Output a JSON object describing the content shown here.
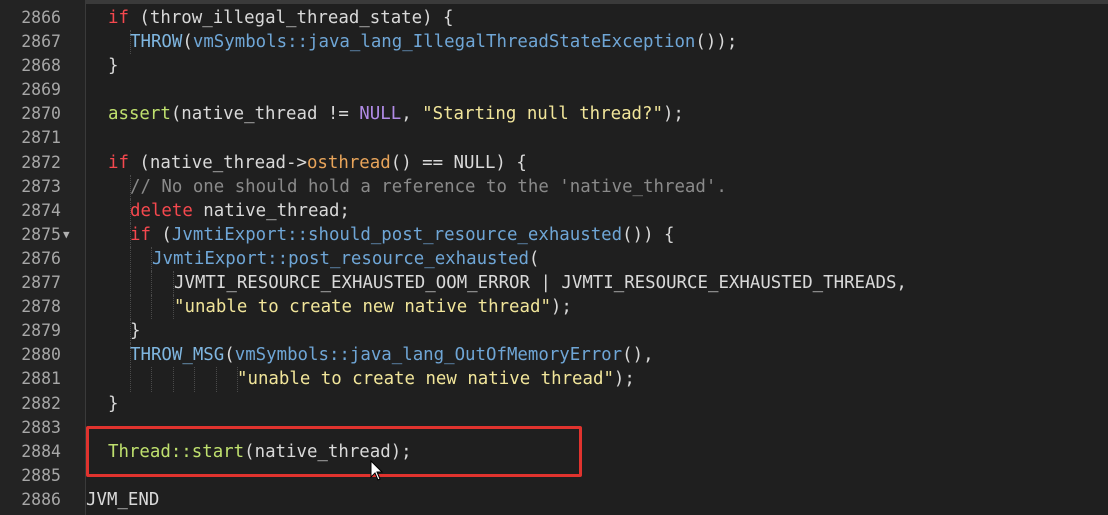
{
  "editor": {
    "lines": [
      {
        "num": "2866",
        "indent": 1,
        "tokens": [
          {
            "t": "if",
            "c": "kw"
          },
          {
            "t": " (throw_illegal_thread_state) {",
            "c": ""
          }
        ]
      },
      {
        "num": "2867",
        "indent": 2,
        "tokens": [
          {
            "t": "THROW",
            "c": "fn"
          },
          {
            "t": "(",
            "c": ""
          },
          {
            "t": "vmSymbols::java_lang_IllegalThreadStateException",
            "c": "ty"
          },
          {
            "t": "());",
            "c": ""
          }
        ]
      },
      {
        "num": "2868",
        "indent": 1,
        "tokens": [
          {
            "t": "}",
            "c": ""
          }
        ]
      },
      {
        "num": "2869",
        "indent": 0,
        "tokens": []
      },
      {
        "num": "2870",
        "indent": 1,
        "tokens": [
          {
            "t": "assert",
            "c": "asrt"
          },
          {
            "t": "(native_thread != ",
            "c": ""
          },
          {
            "t": "NULL",
            "c": "nul"
          },
          {
            "t": ", ",
            "c": ""
          },
          {
            "t": "\"Starting null thread?\"",
            "c": "str"
          },
          {
            "t": ");",
            "c": ""
          }
        ]
      },
      {
        "num": "2871",
        "indent": 0,
        "tokens": []
      },
      {
        "num": "2872",
        "indent": 1,
        "tokens": [
          {
            "t": "if",
            "c": "kw"
          },
          {
            "t": " (native_thread->",
            "c": ""
          },
          {
            "t": "osthread",
            "c": "orange"
          },
          {
            "t": "() == NULL) {",
            "c": ""
          }
        ]
      },
      {
        "num": "2873",
        "indent": 2,
        "tokens": [
          {
            "t": "// No one should hold a reference to the 'native_thread'.",
            "c": "cm"
          }
        ]
      },
      {
        "num": "2874",
        "indent": 2,
        "tokens": [
          {
            "t": "delete",
            "c": "kw"
          },
          {
            "t": " native_thread;",
            "c": ""
          }
        ]
      },
      {
        "num": "2875",
        "indent": 2,
        "fold": "▼",
        "tokens": [
          {
            "t": "if",
            "c": "kw"
          },
          {
            "t": " (",
            "c": ""
          },
          {
            "t": "JvmtiExport::should_post_resource_exhausted",
            "c": "ty"
          },
          {
            "t": "()) {",
            "c": ""
          }
        ]
      },
      {
        "num": "2876",
        "indent": 3,
        "tokens": [
          {
            "t": "JvmtiExport::post_resource_exhausted",
            "c": "ty"
          },
          {
            "t": "(",
            "c": ""
          }
        ]
      },
      {
        "num": "2877",
        "indent": 4,
        "tokens": [
          {
            "t": "JVMTI_RESOURCE_EXHAUSTED_OOM_ERROR | JVMTI_RESOURCE_EXHAUSTED_THREADS,",
            "c": ""
          }
        ]
      },
      {
        "num": "2878",
        "indent": 4,
        "tokens": [
          {
            "t": "\"unable to create new native thread\"",
            "c": "str"
          },
          {
            "t": ");",
            "c": ""
          }
        ]
      },
      {
        "num": "2879",
        "indent": 2,
        "tokens": [
          {
            "t": "}",
            "c": ""
          }
        ]
      },
      {
        "num": "2880",
        "indent": 2,
        "tokens": [
          {
            "t": "THROW_MSG",
            "c": "fn"
          },
          {
            "t": "(",
            "c": ""
          },
          {
            "t": "vmSymbols::java_lang_OutOfMemoryError",
            "c": "ty"
          },
          {
            "t": "(),",
            "c": ""
          }
        ]
      },
      {
        "num": "2881",
        "indent": 7,
        "tokens": [
          {
            "t": "\"unable to create new native thread\"",
            "c": "str"
          },
          {
            "t": ");",
            "c": ""
          }
        ]
      },
      {
        "num": "2882",
        "indent": 1,
        "tokens": [
          {
            "t": "}",
            "c": ""
          }
        ]
      },
      {
        "num": "2883",
        "indent": 0,
        "tokens": []
      },
      {
        "num": "2884",
        "indent": 1,
        "tokens": [
          {
            "t": "Thread::start",
            "c": "grn"
          },
          {
            "t": "(native_thread);",
            "c": ""
          }
        ]
      },
      {
        "num": "2885",
        "indent": 0,
        "tokens": []
      },
      {
        "num": "2886",
        "indent": 0,
        "tokens": [
          {
            "t": "JVM_END",
            "c": ""
          }
        ]
      }
    ]
  },
  "colors": {
    "background": "#1f1f1f",
    "keyword": "#f5484e",
    "string": "#f1e59a",
    "type": "#6fa6d6",
    "highlight_box": "#e0332e"
  },
  "icons": {
    "fold_marker": "fold-triangle-icon",
    "cursor": "mouse-pointer-icon"
  }
}
